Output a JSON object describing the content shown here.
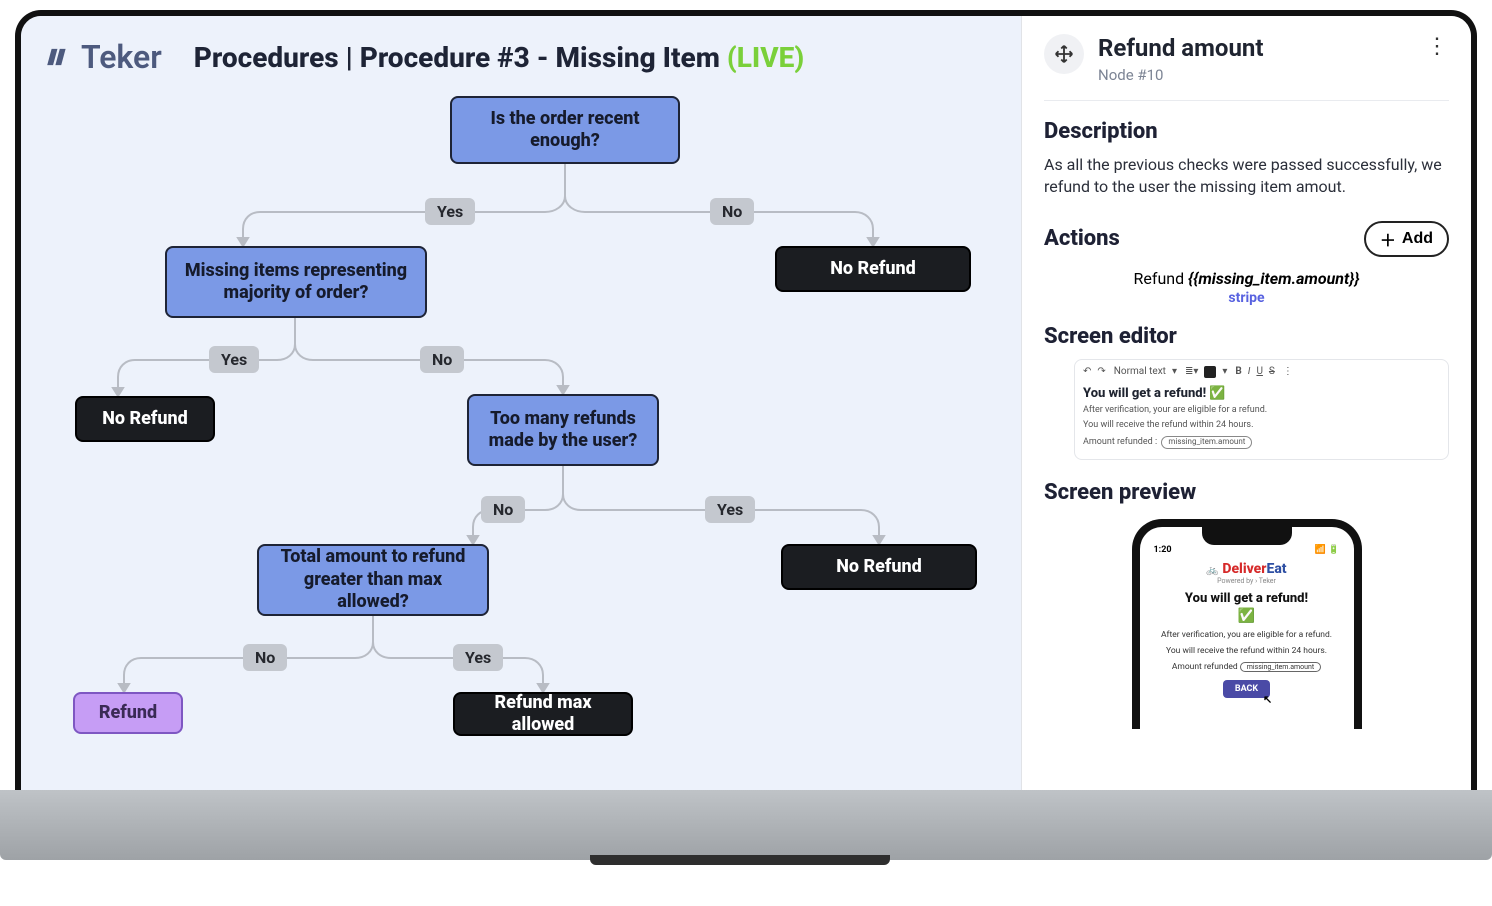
{
  "brand": {
    "name": "Teker"
  },
  "header": {
    "title_prefix": "Procedures | Procedure #3 - Missing Item",
    "status": "(LIVE)"
  },
  "flow": {
    "nodes": {
      "n1": "Is the order recent enough?",
      "n2": "Missing items representing majority of order?",
      "n3": "Too many refunds made by the user?",
      "n4": "Total amount to refund greater than max allowed?",
      "no_refund": "No Refund",
      "refund": "Refund",
      "refund_max": "Refund max allowed"
    },
    "labels": {
      "yes": "Yes",
      "no": "No"
    }
  },
  "panel": {
    "title": "Refund amount",
    "subtitle": "Node #10",
    "description_h": "Description",
    "description": "As all the previous checks were passed successfully, we refund to the user the missing item amout.",
    "actions_h": "Actions",
    "add_label": "Add",
    "action_text_prefix": "Refund ",
    "action_expr": "{{missing_item.amount}}",
    "action_integration": "stripe",
    "screen_editor_h": "Screen editor",
    "screen_preview_h": "Screen preview"
  },
  "editor": {
    "style_select": "Normal text",
    "format_buttons": {
      "bold": "B",
      "italic": "I",
      "underline": "U",
      "strike": "S"
    },
    "heading": "You will get a refund!",
    "check": "✅",
    "line1": "After verification, your are eligible for a refund.",
    "line2": "You will receive the refund within 24 hours.",
    "line3_prefix": "Amount refunded :",
    "chip": "missing_item.amount"
  },
  "phone": {
    "clock": "1:20",
    "brand_d": "Deliver",
    "brand_e": "Eat",
    "powered_by": "Powered by  ›  Teker",
    "heading": "You will get a refund!",
    "line1": "After verification, you are eligible for a refund.",
    "line2": "You will receive the refund within 24 hours.",
    "line3_prefix": "Amount refunded",
    "chip": "missing_item.amount",
    "back_btn": "BACK"
  }
}
